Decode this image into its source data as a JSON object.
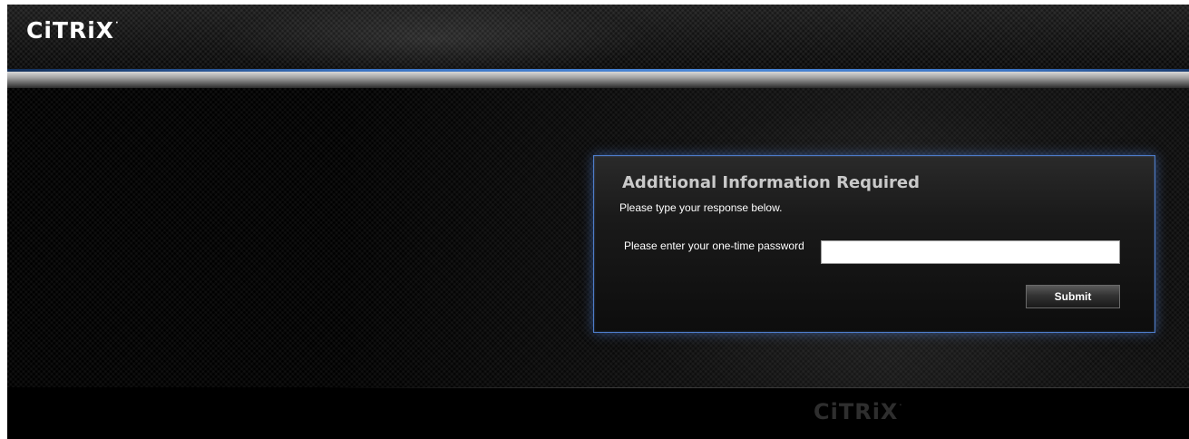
{
  "header": {
    "logo_text": "CiTRiX",
    "logo_mark": "·"
  },
  "panel": {
    "title": "Additional Information Required",
    "subtitle": "Please type your response below.",
    "field_label": "Please enter your one-time password",
    "input_value": "",
    "submit_label": "Submit"
  },
  "footer": {
    "logo_text": "CiTRiX",
    "logo_mark": "·"
  },
  "colors": {
    "accent_blue": "#4d7cc9",
    "background": "#000000",
    "title_gray": "#c9c9c9"
  }
}
